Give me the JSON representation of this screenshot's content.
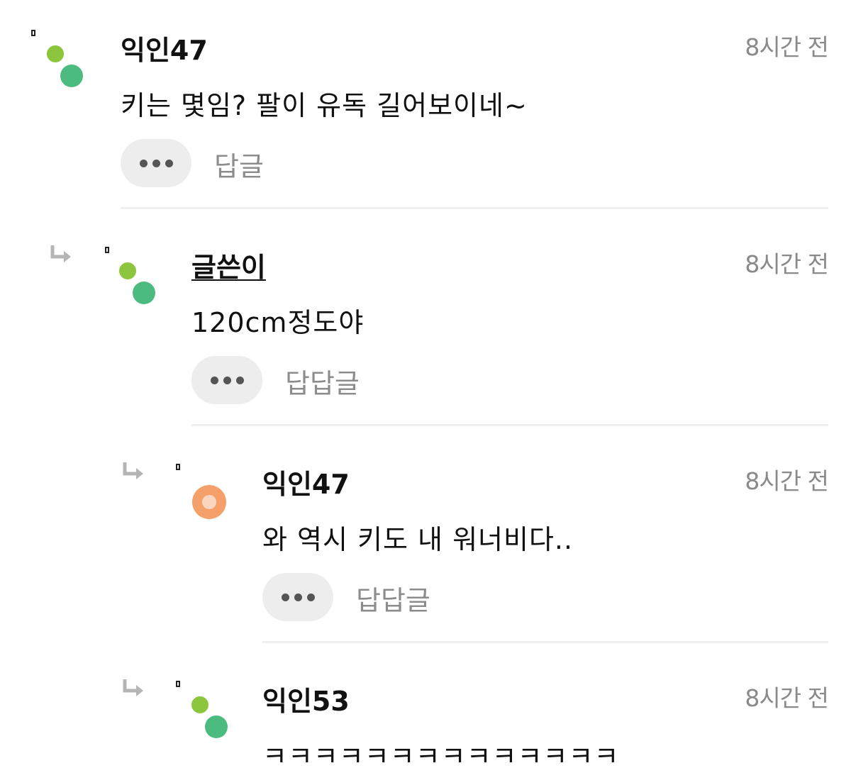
{
  "comments": [
    {
      "author": "익인47",
      "time": "8시간 전",
      "text": "키는 몇임? 팔이 유독 길어보이네~",
      "reply_label": "답글",
      "more_label": "•••"
    },
    {
      "author": "글쓴이",
      "time": "8시간 전",
      "text": "120cm정도야",
      "reply_label": "답답글",
      "more_label": "•••"
    },
    {
      "author": "익인47",
      "time": "8시간 전",
      "text": "와 역시 키도 내 워너비다..",
      "reply_label": "답답글",
      "more_label": "•••"
    },
    {
      "author": "익인53",
      "time": "8시간 전",
      "text": "ㅋㅋㅋㅋㅋㅋㅋㅋㅋㅋㅋㅋㅋㅋ"
    }
  ],
  "colors": {
    "avatar_green_light": "#8cc63f",
    "avatar_green_dark": "#4cbb7f",
    "avatar_peach": "#f5a06b",
    "time_gray": "#8a8a8a",
    "button_bg": "#ededed"
  },
  "icons": {
    "reply_arrow": "reply-arrow-icon",
    "more": "more-dots-icon"
  }
}
